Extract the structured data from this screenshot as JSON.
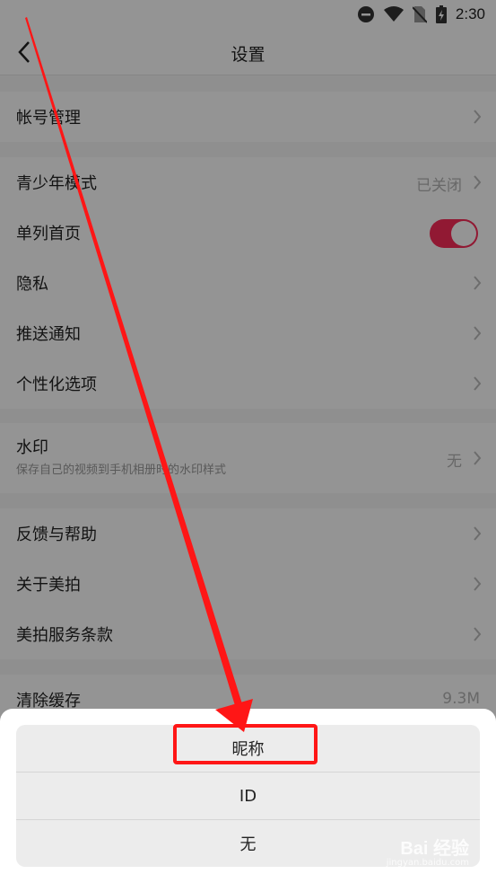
{
  "status_bar": {
    "time": "2:30",
    "icons": [
      "minus-circle-icon",
      "wifi-icon",
      "no-sim-icon",
      "battery-icon"
    ]
  },
  "header": {
    "title": "设置",
    "back_icon": "chevron-left-icon"
  },
  "settings": {
    "account": {
      "label": "帐号管理"
    },
    "youth_mode": {
      "label": "青少年模式",
      "value": "已关闭"
    },
    "single_column": {
      "label": "单列首页",
      "toggle_on": true
    },
    "privacy": {
      "label": "隐私"
    },
    "push": {
      "label": "推送通知"
    },
    "personalization": {
      "label": "个性化选项"
    },
    "watermark": {
      "label": "水印",
      "sub": "保存自己的视频到手机相册时的水印样式",
      "value": "无"
    },
    "feedback": {
      "label": "反馈与帮助"
    },
    "about": {
      "label": "关于美拍"
    },
    "terms": {
      "label": "美拍服务条款"
    },
    "cache": {
      "label": "清除缓存",
      "value": "9.3M"
    }
  },
  "sheet": {
    "options": [
      "昵称",
      "ID",
      "无"
    ]
  },
  "overlay": {
    "watermark_text": "Bai 经验",
    "watermark_sub": "jingyan.baidu.com"
  },
  "colors": {
    "accent": "#fa2c58",
    "annotation": "#ff1616"
  }
}
